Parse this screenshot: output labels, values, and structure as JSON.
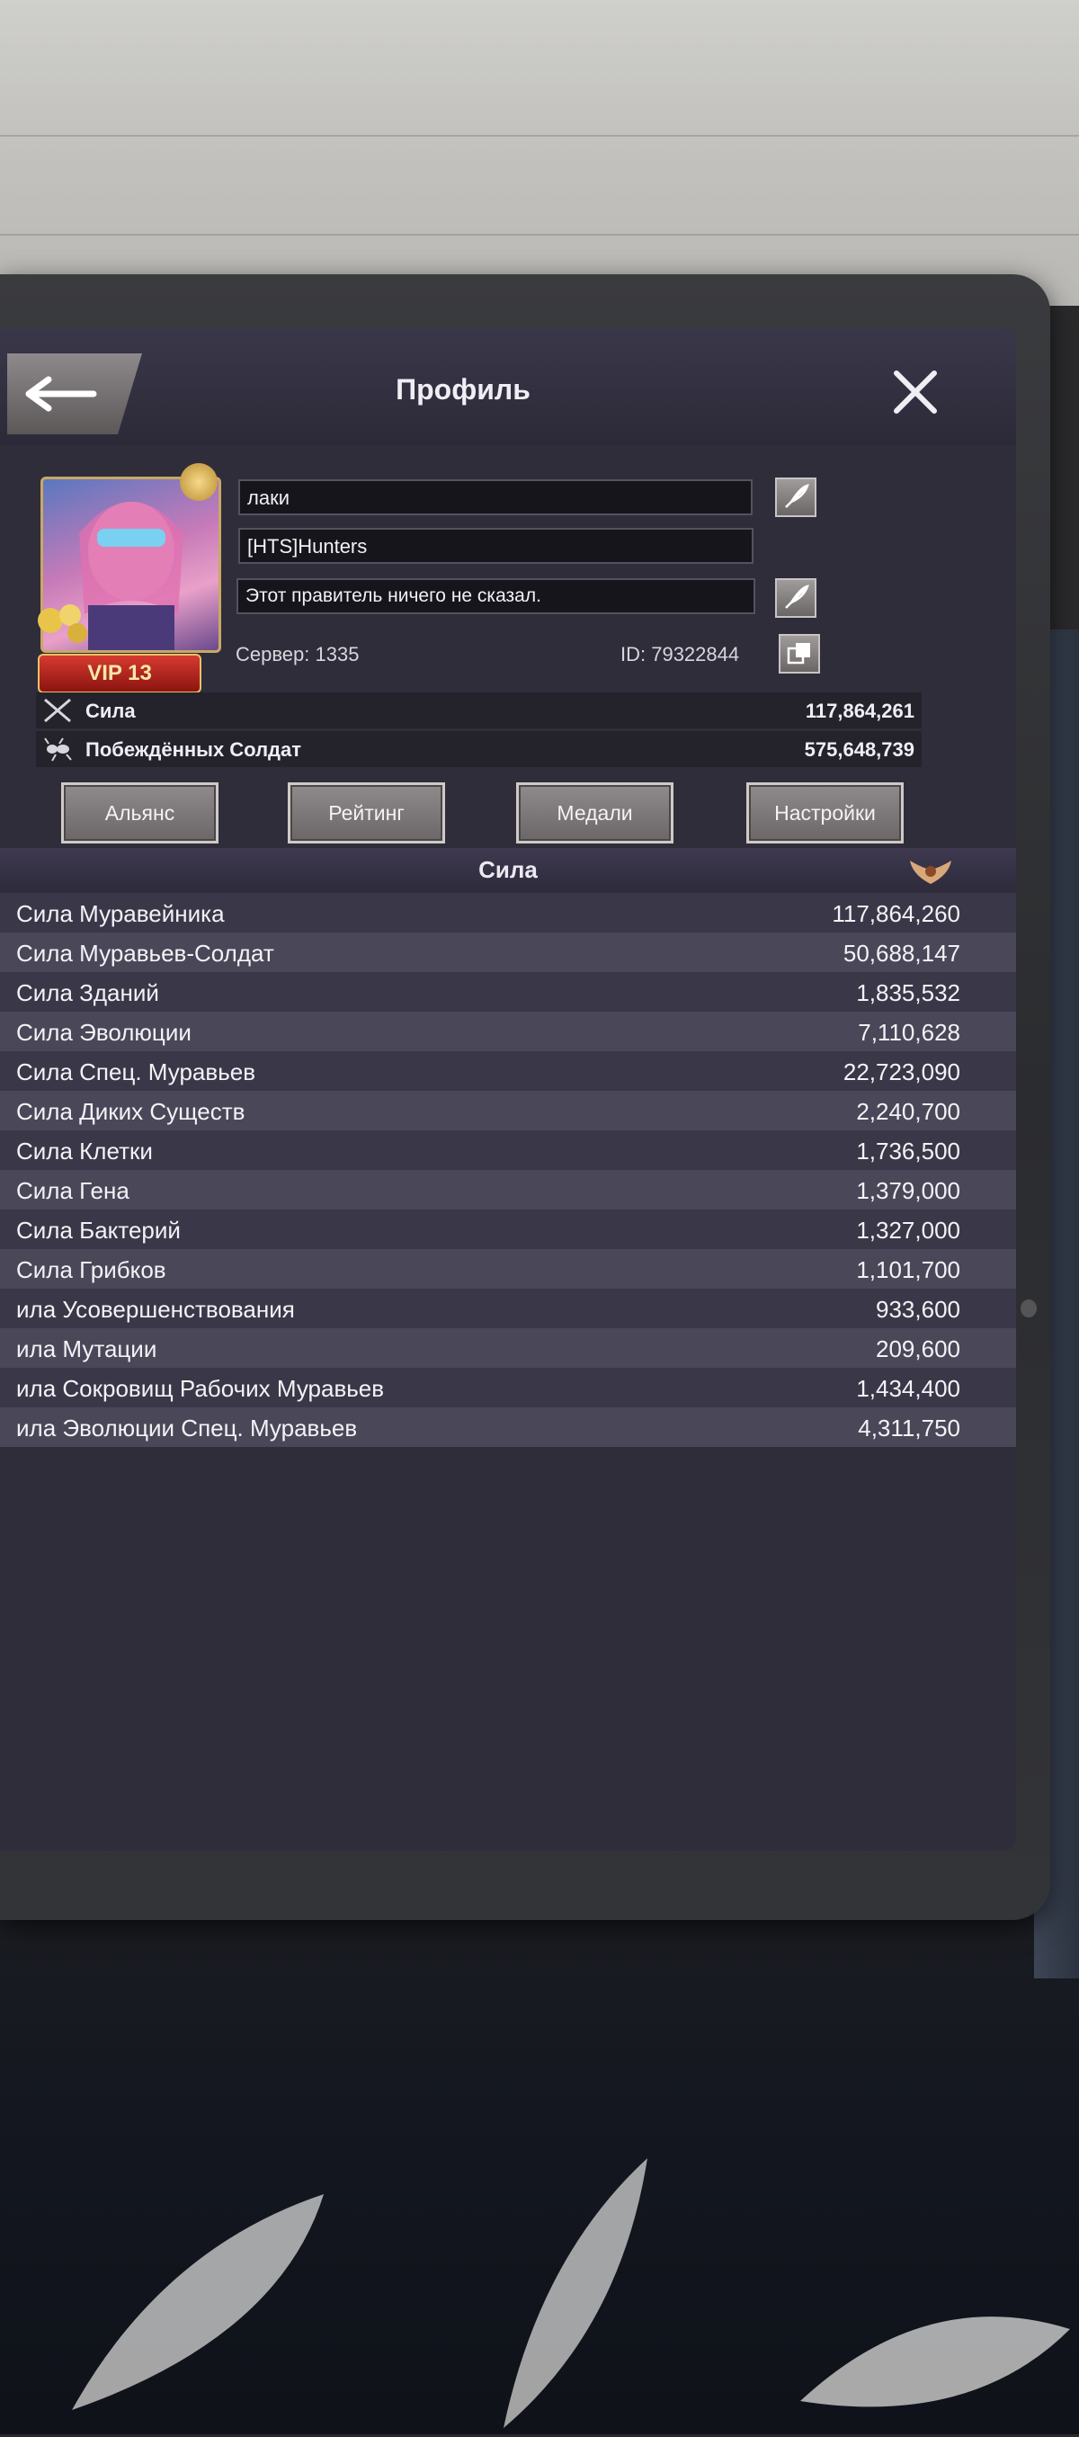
{
  "window": {
    "title": "Профиль"
  },
  "profile": {
    "name": "лаки",
    "alliance": "[HTS]Hunters",
    "motto": "Этот правитель ничего не сказал.",
    "vip": "VIP 13",
    "server": "Сервер: 1335",
    "id": "ID: 79322844"
  },
  "stats": [
    {
      "label": "Сила",
      "value": "117,864,261",
      "icon": "swords-icon"
    },
    {
      "label": "Побеждённых Солдат",
      "value": "575,648,739",
      "icon": "ant-icon"
    }
  ],
  "tabs": [
    "Альянс",
    "Рейтинг",
    "Медали",
    "Настройки"
  ],
  "section": {
    "title": "Сила"
  },
  "power_rows": [
    {
      "name": "Сила Муравейника",
      "value": "117,864,260"
    },
    {
      "name": "Сила Муравьев-Солдат",
      "value": "50,688,147"
    },
    {
      "name": "Сила Зданий",
      "value": "1,835,532"
    },
    {
      "name": "Сила Эволюции",
      "value": "7,110,628"
    },
    {
      "name": "Сила Спец. Муравьев",
      "value": "22,723,090"
    },
    {
      "name": "Сила Диких Существ",
      "value": "2,240,700"
    },
    {
      "name": "Сила Клетки",
      "value": "1,736,500"
    },
    {
      "name": "Сила Гена",
      "value": "1,379,000"
    },
    {
      "name": "Сила Бактерий",
      "value": "1,327,000"
    },
    {
      "name": "Сила Грибков",
      "value": "1,101,700"
    },
    {
      "name": "ила Усовершенствования",
      "value": "933,600"
    },
    {
      "name": "ила Мутации",
      "value": "209,600"
    },
    {
      "name": "ила Сокровищ Рабочих Муравьев",
      "value": "1,434,400"
    },
    {
      "name": "ила Эволюции Спец. Муравьев",
      "value": "4,311,750"
    }
  ],
  "colors": {
    "vip_red": "#c62a22",
    "gold_border": "#c9a864",
    "panel": "#2f2d3a"
  }
}
